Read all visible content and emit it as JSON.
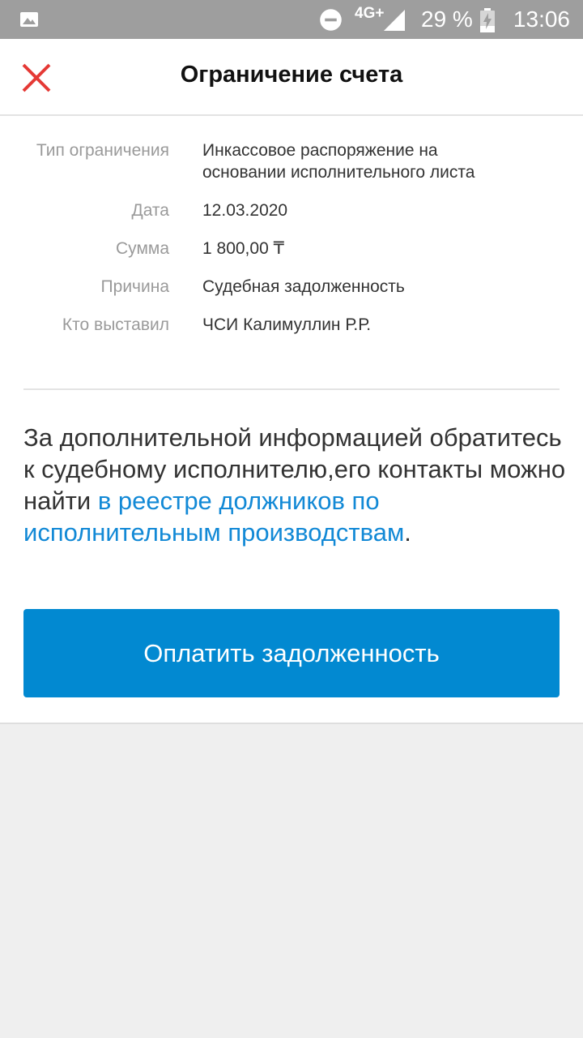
{
  "status_bar": {
    "network": "4G+",
    "battery": "29 %",
    "time": "13:06",
    "icons": [
      "image-icon",
      "do-not-disturb-icon",
      "signal-icon",
      "battery-charging-icon"
    ]
  },
  "header": {
    "title": "Ограничение счета",
    "close_icon": "close-icon",
    "close_color": "#e53935"
  },
  "details": [
    {
      "label": "Тип ограничения",
      "value": "Инкассовое распоряжение на основании исполнительного листа"
    },
    {
      "label": "Дата",
      "value": "12.03.2020"
    },
    {
      "label": "Сумма",
      "value": "1 800,00 ₸"
    },
    {
      "label": "Причина",
      "value": "Судебная задолженность"
    },
    {
      "label": "Кто выставил",
      "value": "ЧСИ Калимуллин Р.Р."
    }
  ],
  "info": {
    "text_before": "За дополнительной информацией обратитесь к судебному исполнителю,его контакты можно найти ",
    "link_text": "в реестре должников по исполнительным производствам",
    "text_after": ".",
    "link_color": "#1289d6"
  },
  "pay_button": {
    "label": "Оплатить задолженность",
    "color": "#0289d1"
  }
}
